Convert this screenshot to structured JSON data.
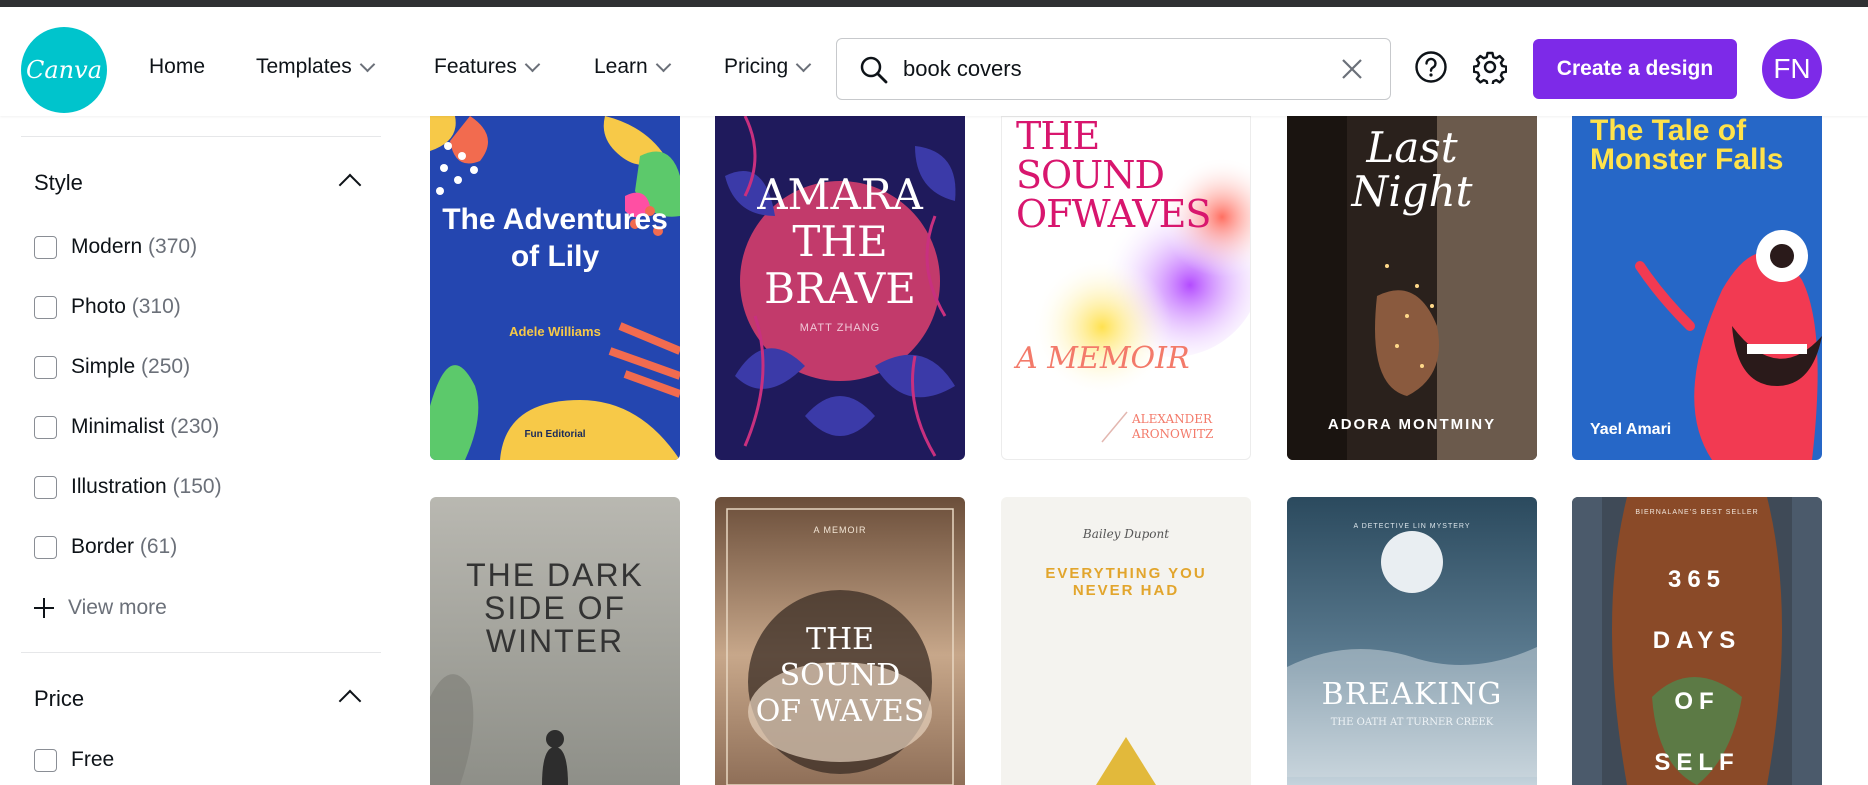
{
  "header": {
    "logo_text": "Canva",
    "nav": [
      {
        "label": "Home",
        "has_dropdown": false
      },
      {
        "label": "Templates",
        "has_dropdown": true
      },
      {
        "label": "Features",
        "has_dropdown": true
      },
      {
        "label": "Learn",
        "has_dropdown": true
      },
      {
        "label": "Pricing",
        "has_dropdown": true
      }
    ],
    "search_value": "book covers",
    "create_label": "Create a design",
    "avatar_initials": "FN",
    "accent": "#7d2ae8",
    "brand": "#00c4cc"
  },
  "sidebar": {
    "style_title": "Style",
    "style_filters": [
      {
        "label": "Modern",
        "count": "(370)"
      },
      {
        "label": "Photo",
        "count": "(310)"
      },
      {
        "label": "Simple",
        "count": "(250)"
      },
      {
        "label": "Minimalist",
        "count": "(230)"
      },
      {
        "label": "Illustration",
        "count": "(150)"
      },
      {
        "label": "Border",
        "count": "(61)"
      }
    ],
    "view_more": "View more",
    "price_title": "Price",
    "price_filters": [
      {
        "label": "Free"
      }
    ]
  },
  "covers": [
    {
      "title": "The Adventures of Lily",
      "author": "Adele Williams",
      "badge": "Fun Editorial"
    },
    {
      "title": "AMARA THE BRAVE",
      "author": "MATT ZHANG"
    },
    {
      "title": "THE SOUND OFWAVES",
      "subtitle": "A MEMOIR",
      "author": "ALEXANDER ARONOWITZ"
    },
    {
      "title": "Last Night",
      "author": "ADORA MONTMINY"
    },
    {
      "title": "The Tale of Monster Falls",
      "author": "Yael Amari"
    },
    {
      "title": "THE DARK SIDE OF WINTER"
    },
    {
      "title": "THE SOUND OF WAVES",
      "kicker": "A MEMOIR"
    },
    {
      "title": "EVERYTHING YOU NEVER HAD",
      "author": "Bailey Dupont"
    },
    {
      "title": "BREAKING",
      "subtitle": "THE OATH AT TURNER CREEK",
      "kicker": "A DETECTIVE LIN MYSTERY"
    },
    {
      "title": "365 DAYS OF SELF",
      "kicker": "BIERNALANE'S BEST SELLER"
    }
  ]
}
